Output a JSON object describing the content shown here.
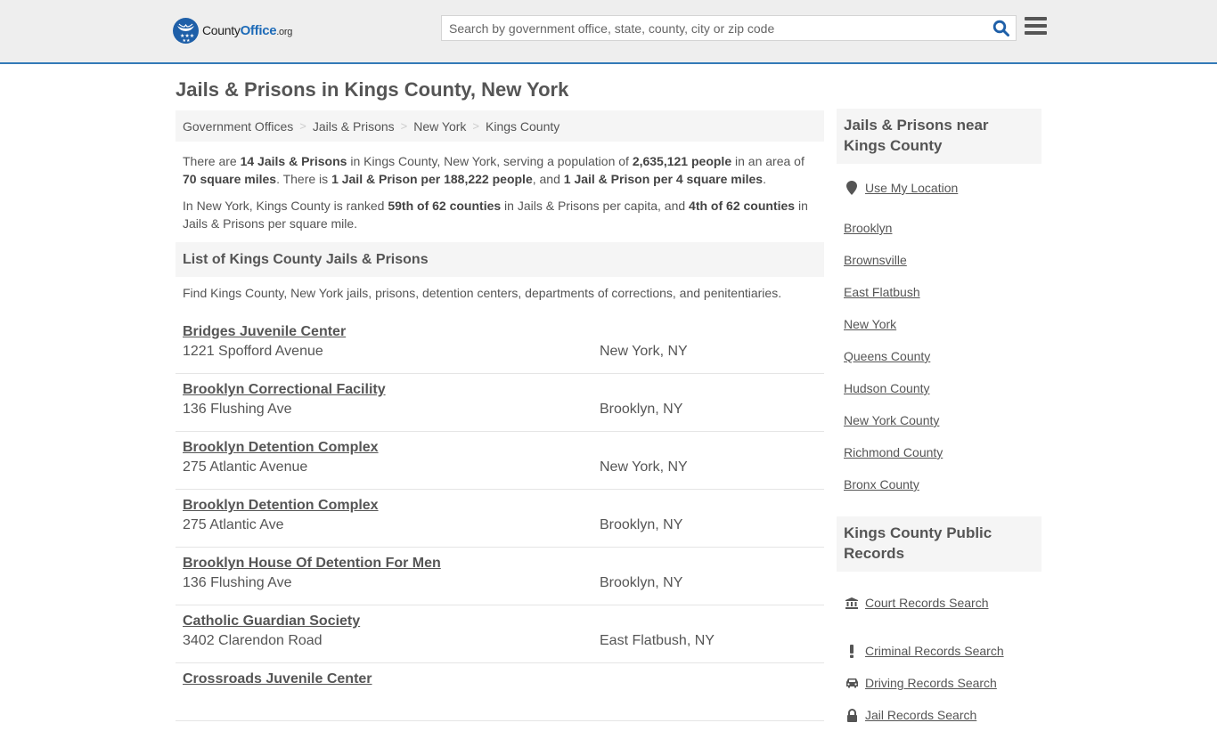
{
  "header": {
    "logo_text_main": "County",
    "logo_text_accent": "Office",
    "logo_text_suffix": ".org",
    "search_placeholder": "Search by government office, state, county, city or zip code",
    "search_icon": "search-icon",
    "menu_icon": "hamburger-menu-icon",
    "accent_color": "#337ab7"
  },
  "page": {
    "title": "Jails & Prisons in Kings County, New York"
  },
  "breadcrumb": [
    {
      "label": "Government Offices"
    },
    {
      "label": "Jails & Prisons"
    },
    {
      "label": "New York"
    },
    {
      "label": "Kings County"
    }
  ],
  "intro": {
    "p1": {
      "t1": "There are ",
      "b1": "14 Jails & Prisons",
      "t2": " in Kings County, New York, serving a population of ",
      "b2": "2,635,121 people",
      "t3": " in an area of ",
      "b3": "70 square miles",
      "t4": ". There is ",
      "b4": "1 Jail & Prison per 188,222 people",
      "t5": ", and ",
      "b5": "1 Jail & Prison per 4 square miles",
      "t6": "."
    },
    "p2": {
      "t1": "In New York, Kings County is ranked ",
      "b1": "59th of 62 counties",
      "t2": " in Jails & Prisons per capita, and ",
      "b2": "4th of 62 counties",
      "t3": " in Jails & Prisons per square mile."
    }
  },
  "list_section": {
    "heading": "List of Kings County Jails & Prisons",
    "description": "Find Kings County, New York jails, prisons, detention centers, departments of corrections, and penitentiaries.",
    "items": [
      {
        "name": "Bridges Juvenile Center",
        "address": "1221 Spofford Avenue",
        "city": "New York, NY"
      },
      {
        "name": "Brooklyn Correctional Facility",
        "address": "136 Flushing Ave",
        "city": "Brooklyn, NY"
      },
      {
        "name": "Brooklyn Detention Complex",
        "address": "275 Atlantic Avenue",
        "city": "New York, NY"
      },
      {
        "name": "Brooklyn Detention Complex",
        "address": "275 Atlantic Ave",
        "city": "Brooklyn, NY"
      },
      {
        "name": "Brooklyn House Of Detention For Men",
        "address": "136 Flushing Ave",
        "city": "Brooklyn, NY"
      },
      {
        "name": "Catholic Guardian Society",
        "address": "3402 Clarendon Road",
        "city": "East Flatbush, NY"
      },
      {
        "name": "Crossroads Juvenile Center",
        "address": "",
        "city": ""
      }
    ]
  },
  "sidebar": {
    "nearby": {
      "heading": "Jails & Prisons near Kings County",
      "use_location": "Use My Location",
      "links": [
        "Brooklyn",
        "Brownsville",
        "East Flatbush",
        "New York",
        "Queens County",
        "Hudson County",
        "New York County",
        "Richmond County",
        "Bronx County"
      ]
    },
    "records": {
      "heading": "Kings County Public Records",
      "links": [
        {
          "label": "Court Records Search",
          "icon": "courthouse-icon"
        },
        {
          "label": "Criminal Records Search",
          "icon": "exclamation-icon"
        },
        {
          "label": "Driving Records Search",
          "icon": "car-icon"
        },
        {
          "label": "Jail Records Search",
          "icon": "lock-icon"
        }
      ]
    }
  }
}
